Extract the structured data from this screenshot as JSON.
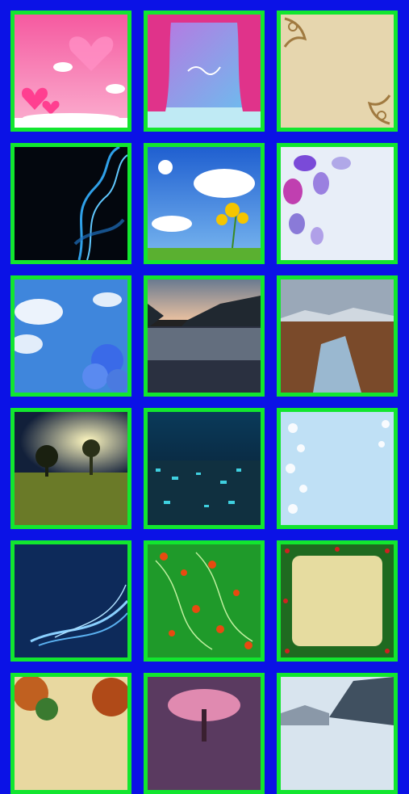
{
  "screen": {
    "background_color": "#0b12e6",
    "tile_border_color": "#12e62f"
  },
  "wallpapers": [
    {
      "name": "pink-hearts",
      "colors": [
        "#f76aa8",
        "#ffffff"
      ]
    },
    {
      "name": "pink-curtain-stage",
      "colors": [
        "#e0338a",
        "#8ad8f0"
      ]
    },
    {
      "name": "vintage-parchment",
      "colors": [
        "#e8d7b0",
        "#b08a50"
      ]
    },
    {
      "name": "blue-smoke-dark",
      "colors": [
        "#02060c",
        "#2fa0e8"
      ]
    },
    {
      "name": "sunflowers-sky",
      "colors": [
        "#2f7fe0",
        "#f5c500"
      ]
    },
    {
      "name": "purple-leaves",
      "colors": [
        "#7a5ad8",
        "#e8eef8"
      ]
    },
    {
      "name": "blue-flowers-clouds",
      "colors": [
        "#3f8fe0",
        "#4a7ae0"
      ]
    },
    {
      "name": "lake-mountains",
      "colors": [
        "#3b4048",
        "#8fa0b0"
      ]
    },
    {
      "name": "rocky-gorge",
      "colors": [
        "#7a4a2a",
        "#8ea0b8"
      ]
    },
    {
      "name": "tree-sunset-field",
      "colors": [
        "#1a2a40",
        "#6a7a28"
      ]
    },
    {
      "name": "city-night-aerial",
      "colors": [
        "#0a3a4a",
        "#3fd0e0"
      ]
    },
    {
      "name": "light-blue-floral",
      "colors": [
        "#bfe0f5",
        "#ffffff"
      ]
    },
    {
      "name": "blue-swirl",
      "colors": [
        "#0d2a5a",
        "#8ad0ff"
      ]
    },
    {
      "name": "green-red-floral",
      "colors": [
        "#1f9a2a",
        "#e84a10"
      ]
    },
    {
      "name": "christmas-frame",
      "colors": [
        "#e8e0a0",
        "#1f6a20"
      ]
    },
    {
      "name": "autumn-trees",
      "colors": [
        "#c06020",
        "#e8d8a0"
      ]
    },
    {
      "name": "pink-blossom-tree",
      "colors": [
        "#c06a8a",
        "#f0a0c0"
      ]
    },
    {
      "name": "rocky-coast",
      "colors": [
        "#405060",
        "#e0e8f0"
      ]
    }
  ]
}
